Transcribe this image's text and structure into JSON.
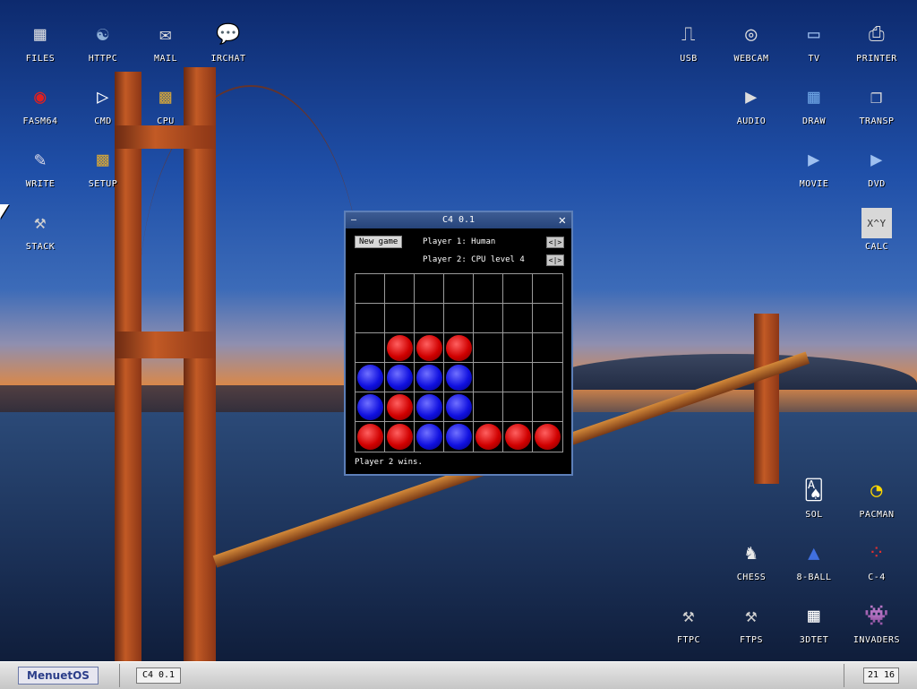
{
  "desktop_icons_left": [
    {
      "label": "FILES",
      "glyph": "▦",
      "icon": "files-icon",
      "color": "#d0d4dc"
    },
    {
      "label": "HTTPC",
      "glyph": "☯",
      "icon": "httpc-icon",
      "color": "#8fb0d8"
    },
    {
      "label": "MAIL",
      "glyph": "✉",
      "icon": "mail-icon",
      "color": "#e0e0e0"
    },
    {
      "label": "IRCHAT",
      "glyph": "💬",
      "icon": "irchat-icon",
      "color": "#f4a040"
    },
    {
      "label": "FASM64",
      "glyph": "◉",
      "icon": "fasm64-icon",
      "color": "#e02020"
    },
    {
      "label": "CMD",
      "glyph": "▷",
      "icon": "cmd-icon",
      "color": "#ffffff"
    },
    {
      "label": "CPU",
      "glyph": "▩",
      "icon": "cpu-icon",
      "color": "#c9a040"
    },
    {
      "label": "WRITE",
      "glyph": "✎",
      "icon": "write-icon",
      "color": "#d8d8e8"
    },
    {
      "label": "SETUP",
      "glyph": "▩",
      "icon": "setup-icon",
      "color": "#c9a040"
    },
    {
      "label": "STACK",
      "glyph": "⚒",
      "icon": "stack-icon",
      "color": "#d0d0d0"
    }
  ],
  "desktop_icons_right": [
    {
      "label": "USB",
      "glyph": "⎍",
      "icon": "usb-icon",
      "color": "#dcdcdc"
    },
    {
      "label": "WEBCAM",
      "glyph": "◎",
      "icon": "webcam-icon",
      "color": "#dcdcdc"
    },
    {
      "label": "TV",
      "glyph": "▭",
      "icon": "tv-icon",
      "color": "#9ec0f0"
    },
    {
      "label": "PRINTER",
      "glyph": "⎙",
      "icon": "printer-icon",
      "color": "#dcdcdc"
    },
    {
      "label": "AUDIO",
      "glyph": "▶",
      "icon": "audio-icon",
      "color": "#dcdcdc"
    },
    {
      "label": "DRAW",
      "glyph": "▦",
      "icon": "draw-icon",
      "color": "#6aa0e0"
    },
    {
      "label": "TRANSP",
      "glyph": "❐",
      "icon": "transp-icon",
      "color": "#dcdcdc"
    },
    {
      "label": "MOVIE",
      "glyph": "▶",
      "icon": "movie-icon",
      "color": "#9ec0f0"
    },
    {
      "label": "DVD",
      "glyph": "▶",
      "icon": "dvd-icon",
      "color": "#9ec0f0"
    },
    {
      "label": "CALC",
      "glyph": "X^Y",
      "icon": "calc-icon",
      "color": "#dcdcdc"
    },
    {
      "label": "SOL",
      "glyph": "🂡",
      "icon": "sol-icon",
      "color": "#ffffff"
    },
    {
      "label": "PACMAN",
      "glyph": "◔",
      "icon": "pacman-icon",
      "color": "#ffd800"
    },
    {
      "label": "CHESS",
      "glyph": "♞",
      "icon": "chess-icon",
      "color": "#e8e8e8"
    },
    {
      "label": "8-BALL",
      "glyph": "▲",
      "icon": "eight-ball-icon",
      "color": "#4070e0"
    },
    {
      "label": "C-4",
      "glyph": "⁘",
      "icon": "c4-icon",
      "color": "#e03030"
    },
    {
      "label": "FTPC",
      "glyph": "⚒",
      "icon": "ftpc-icon",
      "color": "#d0d0d0"
    },
    {
      "label": "FTPS",
      "glyph": "⚒",
      "icon": "ftps-icon",
      "color": "#d0d0d0"
    },
    {
      "label": "3DTET",
      "glyph": "▦",
      "icon": "3dtet-icon",
      "color": "#ffffff"
    },
    {
      "label": "INVADERS",
      "glyph": "👾",
      "icon": "invaders-icon",
      "color": "#c040e0"
    }
  ],
  "window": {
    "title": "C4 0.1",
    "new_game": "New game",
    "player1": "Player 1: Human",
    "player2": "Player 2: CPU level 4",
    "arrows": "<|>",
    "status": "Player 2 wins.",
    "board": [
      [
        "",
        "",
        "",
        "",
        "",
        "",
        ""
      ],
      [
        "",
        "",
        "",
        "",
        "",
        "",
        ""
      ],
      [
        "",
        "R",
        "R",
        "R",
        "",
        "",
        ""
      ],
      [
        "B",
        "B",
        "B",
        "B",
        "",
        "",
        ""
      ],
      [
        "B",
        "R",
        "B",
        "B",
        "",
        "",
        ""
      ],
      [
        "R",
        "R",
        "B",
        "B",
        "R",
        "R",
        "R"
      ]
    ]
  },
  "taskbar": {
    "menu_label": "MenuetOS",
    "task_label": "C4 0.1",
    "clock": "21 16"
  }
}
